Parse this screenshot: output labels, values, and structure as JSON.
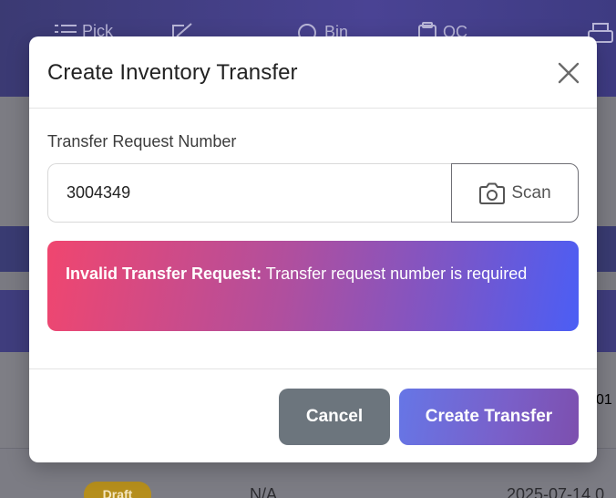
{
  "background": {
    "nav": [
      {
        "label": "Pick",
        "icon": "list-icon"
      },
      {
        "label": "",
        "icon": "edit-icon"
      },
      {
        "label": "Bin",
        "icon": "search-icon"
      },
      {
        "label": "QC",
        "icon": "clipboard-icon"
      },
      {
        "label": "",
        "icon": "printer-icon"
      }
    ],
    "row1_date": "01",
    "row2": {
      "status": "Draft",
      "ref": "N/A",
      "date": "2025-07-14 0"
    }
  },
  "modal": {
    "title": "Create Inventory Transfer",
    "field_label": "Transfer Request Number",
    "input_value": "3004349",
    "scan_label": "Scan",
    "alert": {
      "strong": "Invalid Transfer Request:",
      "message": "Transfer request number is required"
    },
    "cancel_label": "Cancel",
    "create_label": "Create Transfer"
  },
  "colors": {
    "topbar": "#4a4394",
    "alert_start": "#f0466f",
    "alert_end": "#4b5ef5",
    "cancel": "#6c757d",
    "create": "#7a5fc8"
  }
}
